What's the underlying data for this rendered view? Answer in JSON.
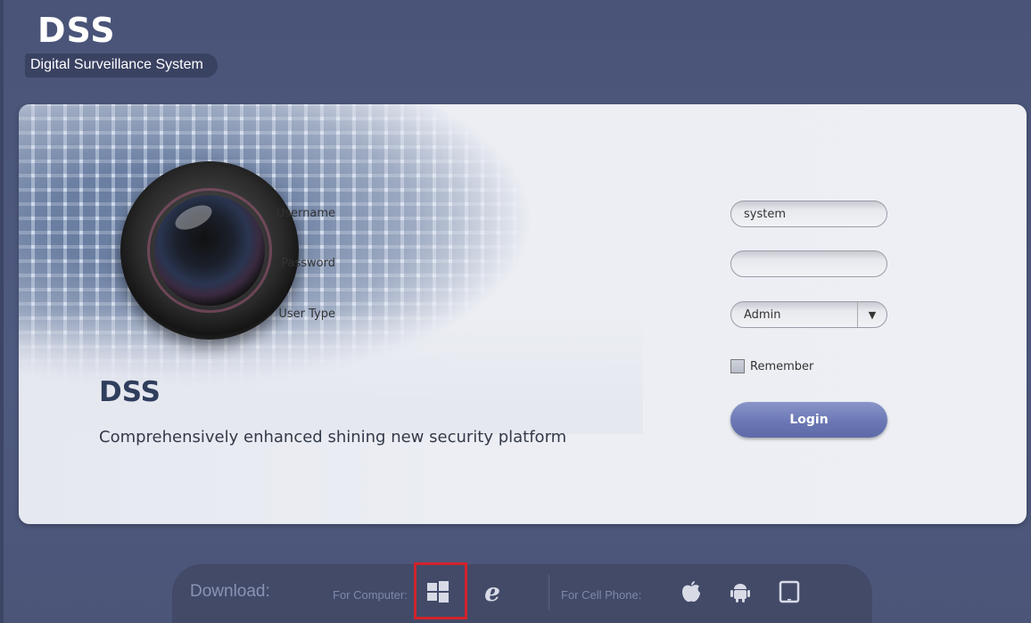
{
  "brand": {
    "title": "DSS",
    "subtitle": "Digital Surveillance System"
  },
  "hero": {
    "title": "DSS",
    "tagline": "Comprehensively enhanced shining new security platform"
  },
  "form": {
    "username_label": "Username",
    "username_value": "system",
    "password_label": "Password",
    "password_value": "",
    "usertype_label": "User Type",
    "usertype_value": "Admin",
    "remember_label": "Remember",
    "remember_checked": false,
    "login_label": "Login"
  },
  "download": {
    "label": "Download:",
    "for_computer": "For Computer:",
    "for_phone": "For Cell Phone:",
    "icons": [
      "windows-icon",
      "internet-explorer-icon",
      "apple-icon",
      "android-icon",
      "tablet-icon"
    ]
  },
  "colors": {
    "background": "#4f5a80",
    "accent": "#6b78b5",
    "highlight": "#d1232a"
  }
}
